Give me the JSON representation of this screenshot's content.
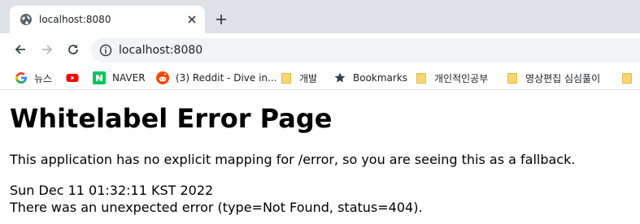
{
  "tab": {
    "title": "localhost:8080"
  },
  "toolbar": {
    "url": "localhost:8080"
  },
  "bookmarks": [
    {
      "label": "뉴스",
      "icon": "google-icon"
    },
    {
      "label": "",
      "icon": "youtube-icon"
    },
    {
      "label": "NAVER",
      "icon": "naver-icon"
    },
    {
      "label": "(3) Reddit - Dive in...",
      "icon": "reddit-icon"
    },
    {
      "label": "개발",
      "icon": "folder-icon"
    },
    {
      "label": "Bookmarks",
      "icon": "star-icon"
    },
    {
      "label": "개인적인공부",
      "icon": "folder-icon"
    },
    {
      "label": "영상편집 심심풀이",
      "icon": "folder-icon"
    }
  ],
  "page": {
    "title": "Whitelabel Error Page",
    "message": "This application has no explicit mapping for /error, so you are seeing this as a fallback.",
    "timestamp": "Sun Dec 11 01:32:11 KST 2022",
    "error": "There was an unexpected error (type=Not Found, status=404)."
  },
  "colors": {
    "tabstrip": "#dee1e6",
    "omnibox": "#f1f3f4",
    "youtube": "#ff0000",
    "naver": "#03c75a",
    "reddit": "#ff4500",
    "folder": "#f9d770"
  }
}
